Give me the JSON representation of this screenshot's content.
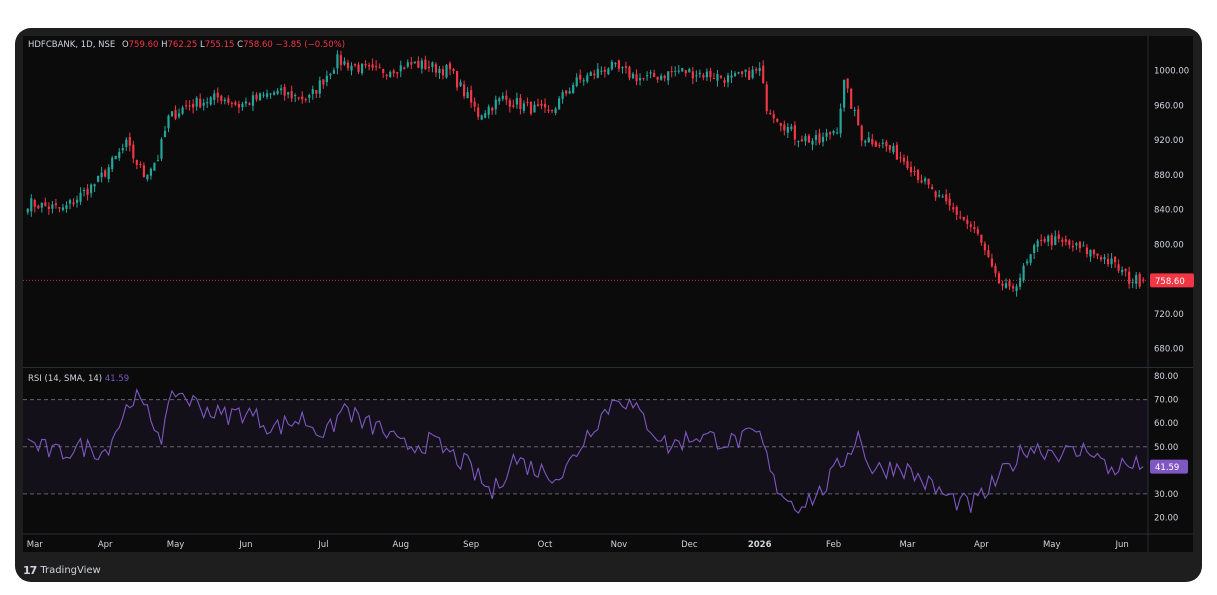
{
  "header": {
    "symbol": "HDFCBANK, 1D, NSE",
    "open_label": "O",
    "open": "759.60",
    "high_label": "H",
    "high": "762.25",
    "low_label": "L",
    "low": "755.15",
    "close_label": "C",
    "close": "758.60",
    "change": "−3.85 (−0.50%)"
  },
  "rsi_header": {
    "label": "RSI (14, SMA, 14)",
    "value": "41.59"
  },
  "footer": {
    "brand": "TradingView",
    "logo_glyph": "17"
  },
  "colors": {
    "up": "#26a69a",
    "down": "#f23645",
    "rsi": "#7e57c2",
    "bg": "#0b0b0c",
    "frame": "#1e1e1e"
  },
  "chart_data": [
    {
      "type": "candlestick",
      "symbol": "HDFCBANK",
      "interval": "1D",
      "exchange": "NSE",
      "price_axis": {
        "ylim": [
          660,
          1040
        ],
        "ticks": [
          680,
          720,
          760,
          800,
          840,
          880,
          920,
          960,
          1000
        ],
        "tick_labels": [
          "680.00",
          "720.00",
          "760.00",
          "800.00",
          "840.00",
          "880.00",
          "920.00",
          "960.00",
          "1000.00"
        ]
      },
      "last_price": 758.6,
      "last_price_label": "758.60",
      "month_labels": [
        "Mar",
        "Apr",
        "May",
        "Jun",
        "Jul",
        "Aug",
        "Sep",
        "Oct",
        "Nov",
        "Dec",
        "2026",
        "Feb",
        "Mar",
        "Apr",
        "May",
        "Jun"
      ],
      "month_start_index": [
        2,
        22,
        42,
        62,
        84,
        106,
        126,
        147,
        168,
        188,
        208,
        229,
        250,
        271,
        291,
        311
      ],
      "anchor_closes": [
        [
          0,
          848
        ],
        [
          10,
          840
        ],
        [
          20,
          873
        ],
        [
          28,
          915
        ],
        [
          33,
          880
        ],
        [
          37,
          900
        ],
        [
          40,
          945
        ],
        [
          45,
          960
        ],
        [
          55,
          970
        ],
        [
          60,
          960
        ],
        [
          70,
          975
        ],
        [
          80,
          968
        ],
        [
          88,
          1012
        ],
        [
          98,
          998
        ],
        [
          110,
          1008
        ],
        [
          120,
          1000
        ],
        [
          128,
          950
        ],
        [
          135,
          968
        ],
        [
          148,
          950
        ],
        [
          155,
          985
        ],
        [
          165,
          1005
        ],
        [
          175,
          990
        ],
        [
          185,
          1000
        ],
        [
          195,
          995
        ],
        [
          200,
          990
        ],
        [
          208,
          1000
        ],
        [
          210,
          960
        ],
        [
          218,
          925
        ],
        [
          225,
          918
        ],
        [
          230,
          935
        ],
        [
          232,
          985
        ],
        [
          237,
          925
        ],
        [
          243,
          915
        ],
        [
          250,
          895
        ],
        [
          258,
          855
        ],
        [
          265,
          833
        ],
        [
          270,
          810
        ],
        [
          275,
          760
        ],
        [
          279,
          745
        ],
        [
          283,
          770
        ],
        [
          288,
          808
        ],
        [
          295,
          800
        ],
        [
          305,
          787
        ],
        [
          310,
          772
        ],
        [
          313,
          760
        ],
        [
          317,
          758
        ]
      ],
      "n_candles": 318,
      "candles": []
    },
    {
      "type": "line",
      "name": "RSI (14, SMA, 14)",
      "ylim": [
        13,
        83
      ],
      "ticks": [
        20,
        30,
        40,
        50,
        60,
        70,
        80
      ],
      "tick_labels": [
        "20.00",
        "30.00",
        "40.00",
        "50.00",
        "60.00",
        "70.00",
        "80.00"
      ],
      "bands": [
        30,
        50,
        70
      ],
      "last_value": 41.59,
      "last_value_label": "41.59",
      "anchor_values": [
        [
          0,
          52
        ],
        [
          8,
          47
        ],
        [
          16,
          50
        ],
        [
          22,
          48
        ],
        [
          30,
          72
        ],
        [
          35,
          62
        ],
        [
          38,
          55
        ],
        [
          42,
          74
        ],
        [
          48,
          68
        ],
        [
          55,
          63
        ],
        [
          62,
          65
        ],
        [
          70,
          58
        ],
        [
          78,
          62
        ],
        [
          85,
          55
        ],
        [
          90,
          67
        ],
        [
          95,
          60
        ],
        [
          100,
          58
        ],
        [
          106,
          50
        ],
        [
          115,
          52
        ],
        [
          125,
          42
        ],
        [
          132,
          30
        ],
        [
          138,
          45
        ],
        [
          145,
          40
        ],
        [
          152,
          38
        ],
        [
          160,
          58
        ],
        [
          168,
          72
        ],
        [
          175,
          62
        ],
        [
          182,
          50
        ],
        [
          190,
          55
        ],
        [
          200,
          52
        ],
        [
          208,
          55
        ],
        [
          212,
          35
        ],
        [
          218,
          25
        ],
        [
          225,
          30
        ],
        [
          232,
          45
        ],
        [
          236,
          55
        ],
        [
          240,
          40
        ],
        [
          248,
          42
        ],
        [
          255,
          35
        ],
        [
          262,
          28
        ],
        [
          268,
          25
        ],
        [
          272,
          30
        ],
        [
          278,
          40
        ],
        [
          284,
          50
        ],
        [
          292,
          48
        ],
        [
          298,
          47
        ],
        [
          302,
          50
        ],
        [
          307,
          40
        ],
        [
          311,
          42
        ],
        [
          317,
          41.59
        ]
      ],
      "values": []
    }
  ]
}
